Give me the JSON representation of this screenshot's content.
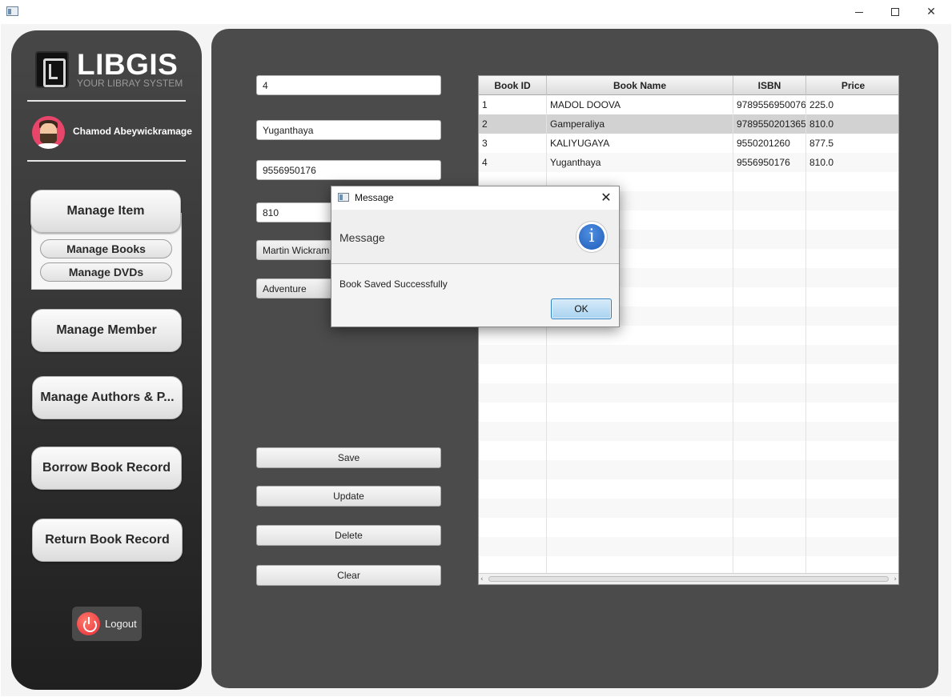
{
  "window": {
    "minimize": "—",
    "maximize": "☐",
    "close": "✕"
  },
  "sidebar": {
    "logo_title": "LIBGIS",
    "logo_subtitle": "YOUR LIBRAY SYSTEM",
    "user_name": "Chamod Abeywickramage",
    "manage_item": "Manage Item",
    "manage_books": "Manage Books",
    "manage_dvds": "Manage DVDs",
    "manage_member": "Manage Member",
    "manage_authors": "Manage Authors & P...",
    "borrow_record": "Borrow Book Record",
    "return_record": "Return Book Record",
    "logout": "Logout"
  },
  "form": {
    "book_id": "4",
    "book_name": "Yuganthaya",
    "isbn": "9556950176",
    "price": "810",
    "author": "Martin Wickram",
    "category": "Adventure",
    "save": "Save",
    "update": "Update",
    "delete": "Delete",
    "clear": "Clear"
  },
  "table": {
    "columns": [
      "Book ID",
      "Book Name",
      "ISBN",
      "Price"
    ],
    "rows": [
      [
        "1",
        "MADOL DOOVA",
        "9789556950076",
        "225.0"
      ],
      [
        "2",
        "Gamperaliya",
        "9789550201365",
        "810.0"
      ],
      [
        "3",
        "KALIYUGAYA",
        "9550201260",
        "877.5"
      ],
      [
        "4",
        "Yuganthaya",
        "9556950176",
        "810.0"
      ]
    ],
    "selected_row": 2
  },
  "dialog": {
    "title": "Message",
    "header": "Message",
    "message": "Book Saved Successfully",
    "ok": "OK",
    "info_glyph": "i"
  },
  "colors": {
    "sidebar_top": "#474747",
    "sidebar_bottom": "#1f1f1f",
    "main_panel": "#4b4b4b",
    "avatar_bg": "#e8456a",
    "logout_icon": "#e82a36",
    "ok_button": "#a9d2f0",
    "info_icon": "#1f5cbb"
  }
}
